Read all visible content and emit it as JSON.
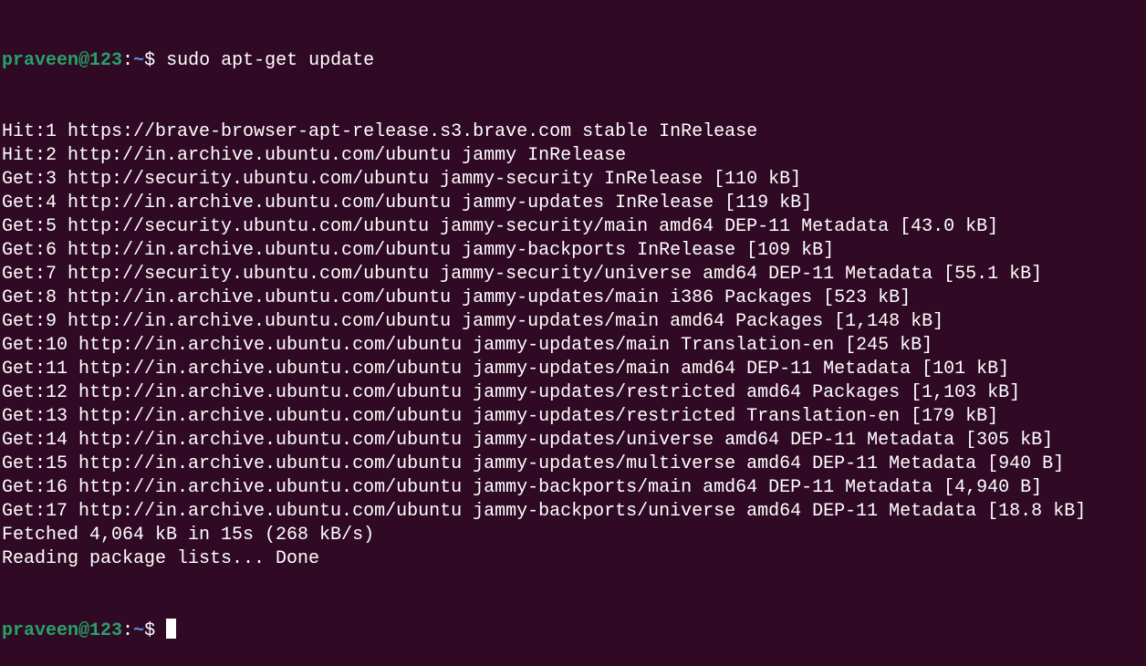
{
  "prompt": {
    "user_host": "praveen@123",
    "colon": ":",
    "path": "~",
    "symbol": "$ "
  },
  "command": "sudo apt-get update",
  "output": [
    "Hit:1 https://brave-browser-apt-release.s3.brave.com stable InRelease",
    "Hit:2 http://in.archive.ubuntu.com/ubuntu jammy InRelease",
    "Get:3 http://security.ubuntu.com/ubuntu jammy-security InRelease [110 kB]",
    "Get:4 http://in.archive.ubuntu.com/ubuntu jammy-updates InRelease [119 kB]",
    "Get:5 http://security.ubuntu.com/ubuntu jammy-security/main amd64 DEP-11 Metadata [43.0 kB]",
    "Get:6 http://in.archive.ubuntu.com/ubuntu jammy-backports InRelease [109 kB]",
    "Get:7 http://security.ubuntu.com/ubuntu jammy-security/universe amd64 DEP-11 Metadata [55.1 kB]",
    "Get:8 http://in.archive.ubuntu.com/ubuntu jammy-updates/main i386 Packages [523 kB]",
    "Get:9 http://in.archive.ubuntu.com/ubuntu jammy-updates/main amd64 Packages [1,148 kB]",
    "Get:10 http://in.archive.ubuntu.com/ubuntu jammy-updates/main Translation-en [245 kB]",
    "Get:11 http://in.archive.ubuntu.com/ubuntu jammy-updates/main amd64 DEP-11 Metadata [101 kB]",
    "Get:12 http://in.archive.ubuntu.com/ubuntu jammy-updates/restricted amd64 Packages [1,103 kB]",
    "Get:13 http://in.archive.ubuntu.com/ubuntu jammy-updates/restricted Translation-en [179 kB]",
    "Get:14 http://in.archive.ubuntu.com/ubuntu jammy-updates/universe amd64 DEP-11 Metadata [305 kB]",
    "Get:15 http://in.archive.ubuntu.com/ubuntu jammy-updates/multiverse amd64 DEP-11 Metadata [940 B]",
    "Get:16 http://in.archive.ubuntu.com/ubuntu jammy-backports/main amd64 DEP-11 Metadata [4,940 B]",
    "Get:17 http://in.archive.ubuntu.com/ubuntu jammy-backports/universe amd64 DEP-11 Metadata [18.8 kB]",
    "Fetched 4,064 kB in 15s (268 kB/s)",
    "Reading package lists... Done"
  ],
  "colors": {
    "background": "#300a24",
    "user_host": "#26a269",
    "path": "#5a8fd6",
    "text": "#ffffff"
  }
}
